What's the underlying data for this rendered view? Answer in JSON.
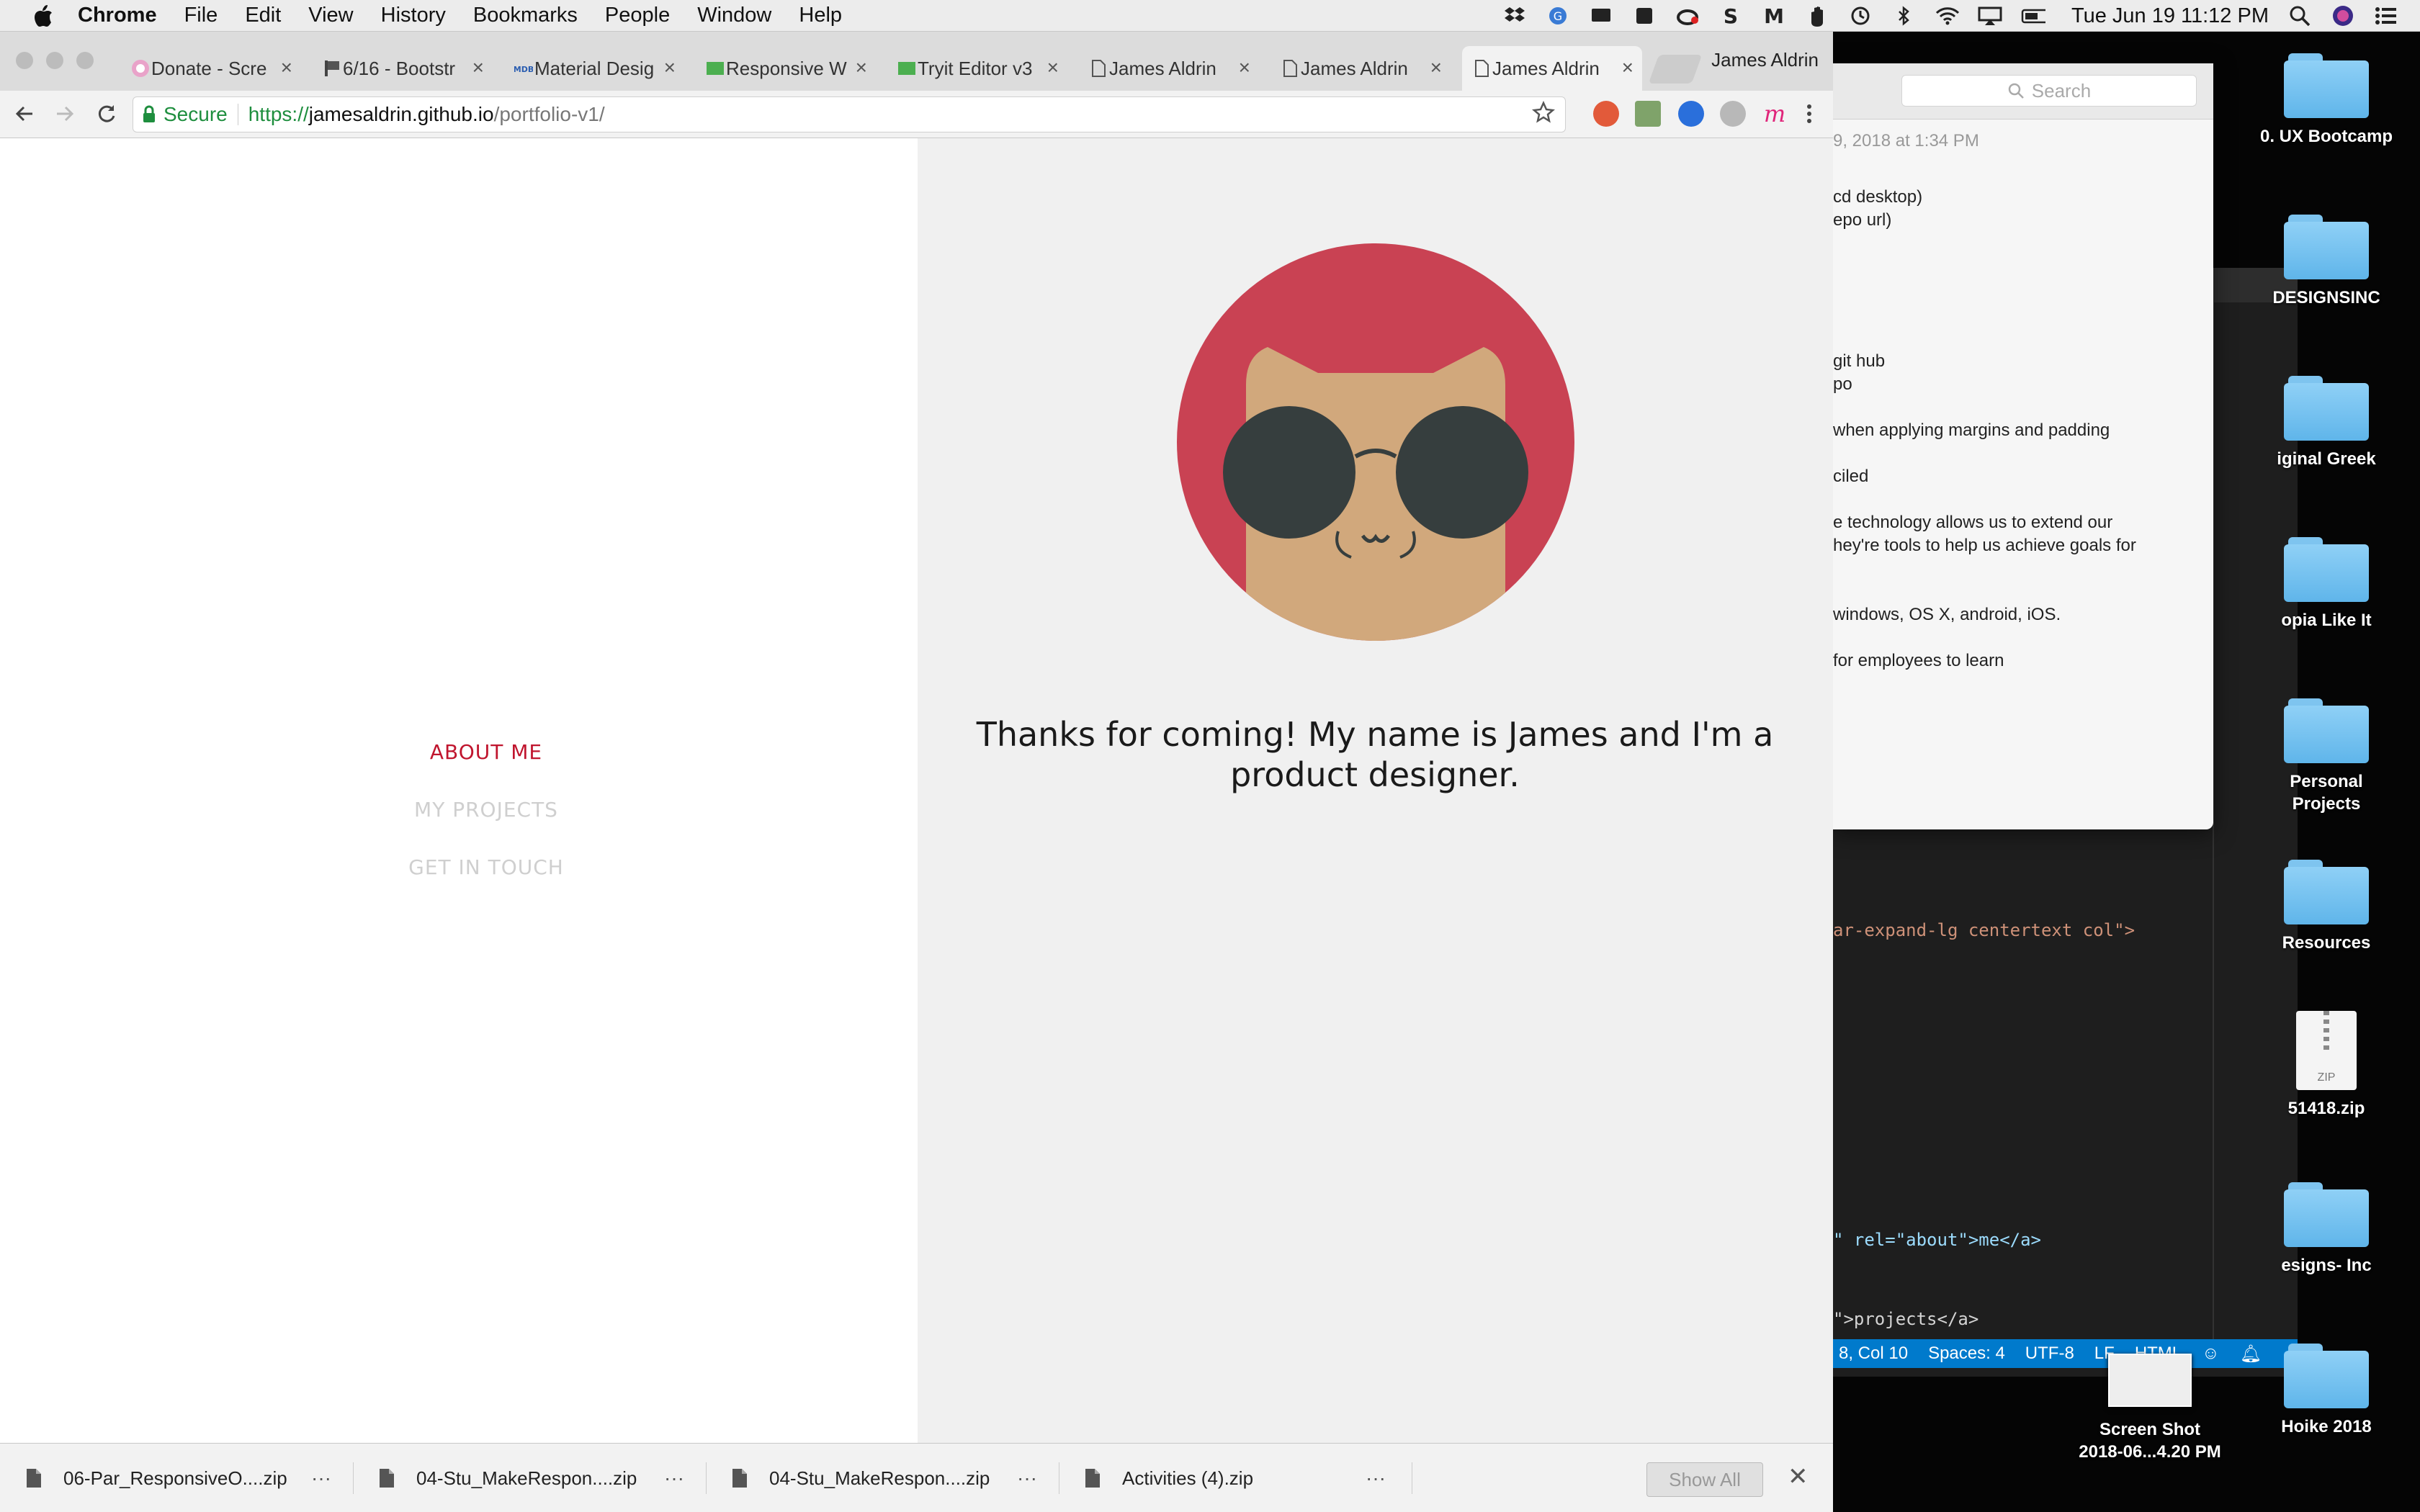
{
  "menubar": {
    "app_name": "Chrome",
    "items": [
      "File",
      "Edit",
      "View",
      "History",
      "Bookmarks",
      "People",
      "Window",
      "Help"
    ],
    "clock": "Tue Jun 19  11:12 PM",
    "status_icons": [
      "dropbox-icon",
      "grammarly-icon",
      "screen-icon",
      "evernote-icon",
      "creative-cloud-icon",
      "skype-icon",
      "malwarebytes-icon",
      "hand-icon",
      "sync-icon",
      "bluetooth-icon",
      "wifi-icon",
      "airplay-icon",
      "battery-icon"
    ]
  },
  "desktop": {
    "icons": [
      {
        "label": "0. UX Bootcamp"
      },
      {
        "label": "DESIGNSINC"
      },
      {
        "label": "iginal Greek"
      },
      {
        "label": "opia Like It"
      },
      {
        "label": "Personal\nProjects"
      },
      {
        "label": "Resources"
      },
      {
        "label": "51418.zip",
        "type": "zip"
      },
      {
        "label": "esigns- Inc"
      },
      {
        "label": "Hoike 2018"
      }
    ],
    "screenshot_label": "Screen Shot\n2018-06...4.20 PM",
    "zip_badge": "ZIP"
  },
  "notes": {
    "search_placeholder": "Search",
    "date": "9, 2018 at 1:34 PM",
    "lines": [
      "cd desktop)",
      "epo url)",
      "git hub",
      "po",
      "when applying margins and padding",
      "ciled",
      "e technology allows us to extend our",
      "hey're tools to help us achieve goals for",
      " windows, OS X, android, iOS.",
      "for employees to learn"
    ]
  },
  "editor": {
    "code_lines": [
      {
        "text": "ar-expand-lg centertext col\">",
        "color": "#ce9178"
      },
      {
        "text": "\" rel=\"about\">me</a>",
        "color": "#9cdcfe"
      },
      {
        "text": "\">projects</a>",
        "color": "#d4d4d4"
      }
    ],
    "status_items": [
      "8, Col 10",
      "Spaces: 4",
      "UTF-8",
      "LF",
      "HTML"
    ]
  },
  "browser": {
    "tabs": [
      {
        "title": "Donate - Scre"
      },
      {
        "title": "6/16 - Bootstr"
      },
      {
        "title": "Material Desig"
      },
      {
        "title": "Responsive W"
      },
      {
        "title": "Tryit Editor v3"
      },
      {
        "title": "James Aldrin"
      },
      {
        "title": "James Aldrin"
      },
      {
        "title": "James Aldrin"
      }
    ],
    "active_tab": 7,
    "profile_name": "James Aldrin",
    "url": {
      "secure_label": "Secure",
      "scheme": "https://",
      "host": "jamesaldrin.github.io",
      "path": "/portfolio-v1/"
    }
  },
  "page": {
    "nav": [
      {
        "label": "ABOUT ME",
        "state": "active"
      },
      {
        "label": "MY PROJECTS",
        "state": "inactive"
      },
      {
        "label": "GET IN TOUCH",
        "state": "inactive"
      }
    ],
    "intro": "Thanks for coming! My name is James and I'm a product designer.",
    "colors": {
      "accent": "#c0152e",
      "avatar_bg": "#c94253",
      "cat": "#d1a87c",
      "glasses": "#363e3e"
    }
  },
  "downloads": {
    "items": [
      {
        "name": "06-Par_ResponsiveO....zip"
      },
      {
        "name": "04-Stu_MakeRespon....zip"
      },
      {
        "name": "04-Stu_MakeRespon....zip"
      },
      {
        "name": "Activities (4).zip"
      }
    ],
    "show_all": "Show All"
  }
}
